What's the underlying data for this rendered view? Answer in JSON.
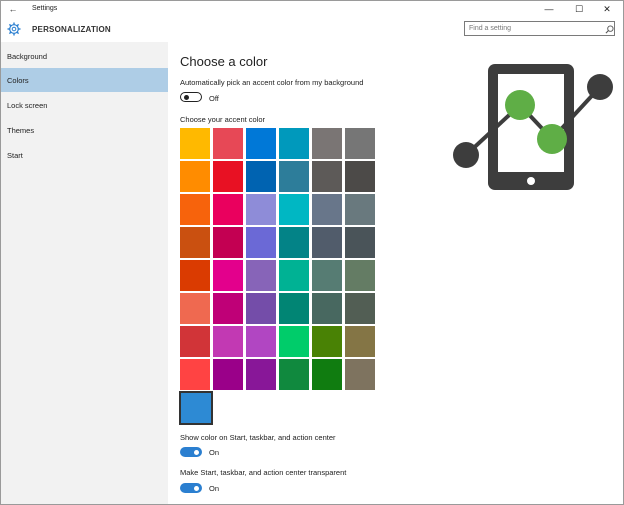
{
  "window": {
    "title": "Settings",
    "back_icon": "back-arrow-icon",
    "min_glyph": "—",
    "max_glyph": "☐",
    "close_glyph": "✕"
  },
  "header": {
    "title": "PERSONALIZATION",
    "search_placeholder": "Find a setting"
  },
  "sidebar": {
    "items": [
      {
        "label": "Background"
      },
      {
        "label": "Colors"
      },
      {
        "label": "Lock screen"
      },
      {
        "label": "Themes"
      },
      {
        "label": "Start"
      }
    ],
    "active_index": 1
  },
  "main": {
    "title": "Choose a color",
    "auto_pick_label": "Automatically pick an accent color from my background",
    "auto_pick_state": "Off",
    "accent_label": "Choose your accent color",
    "swatch_rows": [
      [
        "#ffb900",
        "#e74856",
        "#0078d7",
        "#0099bc",
        "#7a7574",
        "#767676"
      ],
      [
        "#ff8c00",
        "#e81123",
        "#0063b1",
        "#2d7d9a",
        "#5d5a58",
        "#4c4a48"
      ],
      [
        "#f7630c",
        "#ea005e",
        "#8e8cd8",
        "#00b7c3",
        "#68768a",
        "#69797e"
      ],
      [
        "#ca5010",
        "#c30052",
        "#6b69d6",
        "#038387",
        "#515c6b",
        "#4a5459"
      ],
      [
        "#da3b01",
        "#e3008c",
        "#8764b8",
        "#00b294",
        "#567c73",
        "#647c64"
      ],
      [
        "#ef6950",
        "#bf0077",
        "#744da9",
        "#018574",
        "#486860",
        "#525e54"
      ],
      [
        "#d13438",
        "#c239b3",
        "#b146c2",
        "#00cc6a",
        "#498205",
        "#847545"
      ],
      [
        "#ff4343",
        "#9a0089",
        "#881798",
        "#10893e",
        "#107c10",
        "#7e735f"
      ]
    ],
    "selected_color": "#2d8ad4",
    "show_color_label": "Show color on Start, taskbar, and action center",
    "show_color_state": "On",
    "transparent_label": "Make Start, taskbar, and action center transparent",
    "transparent_state": "On"
  },
  "colors": {
    "accent": "#2b7fd0",
    "sidebar_active": "#aecde6",
    "logo_dark": "#3d3d3d",
    "logo_green": "#4caf50"
  }
}
